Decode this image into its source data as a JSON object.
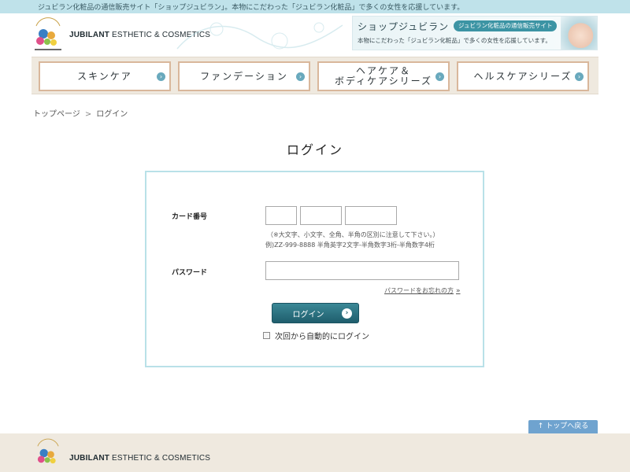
{
  "topbar": {
    "text": "ジュビラン化粧品の通信販売サイト「ショップジュビラン」。本物にこだわった「ジュビラン化粧品」で多くの女性を応援しています。"
  },
  "header": {
    "brand_bold": "JUBILANT",
    "brand_rest": " ESTHETIC & COSMETICS",
    "banner": {
      "title": "ショップジュビラン",
      "pill": "ジュビラン化粧品の通信販売サイト",
      "sub": "本物にこだわった「ジュビラン化粧品」で多くの女性を応援しています。"
    }
  },
  "nav": [
    {
      "label": "スキンケア"
    },
    {
      "label": "ファンデーション"
    },
    {
      "label": "ヘアケア＆\nボディケアシリーズ"
    },
    {
      "label": "ヘルスケアシリーズ"
    }
  ],
  "breadcrumb": {
    "home": "トップページ",
    "sep": ">",
    "current": "ログイン"
  },
  "page_title": "ログイン",
  "form": {
    "card_label": "カード番号",
    "note1": "（※大文字、小文字、全角、半角の区別に注意して下さい。）",
    "note2": "例)ZZ-999-8888 半角英字2文字-半角数字3桁-半角数字4桁",
    "password_label": "パスワード",
    "forgot": "パスワードをお忘れの方",
    "forgot_arrow": "»",
    "login_button": "ログイン",
    "auto_login": "次回から自動的にログイン"
  },
  "to_top": "↑ トップへ戻る",
  "footer": {
    "brand_bold": "JUBILANT",
    "brand_rest": " ESTHETIC & COSMETICS"
  },
  "colors": {
    "topbar": "#bfe2ea",
    "nav_border": "#d9b79b",
    "accent": "#1f5e6d",
    "box_border": "#b9e1e8",
    "totop": "#6fa3cf"
  }
}
